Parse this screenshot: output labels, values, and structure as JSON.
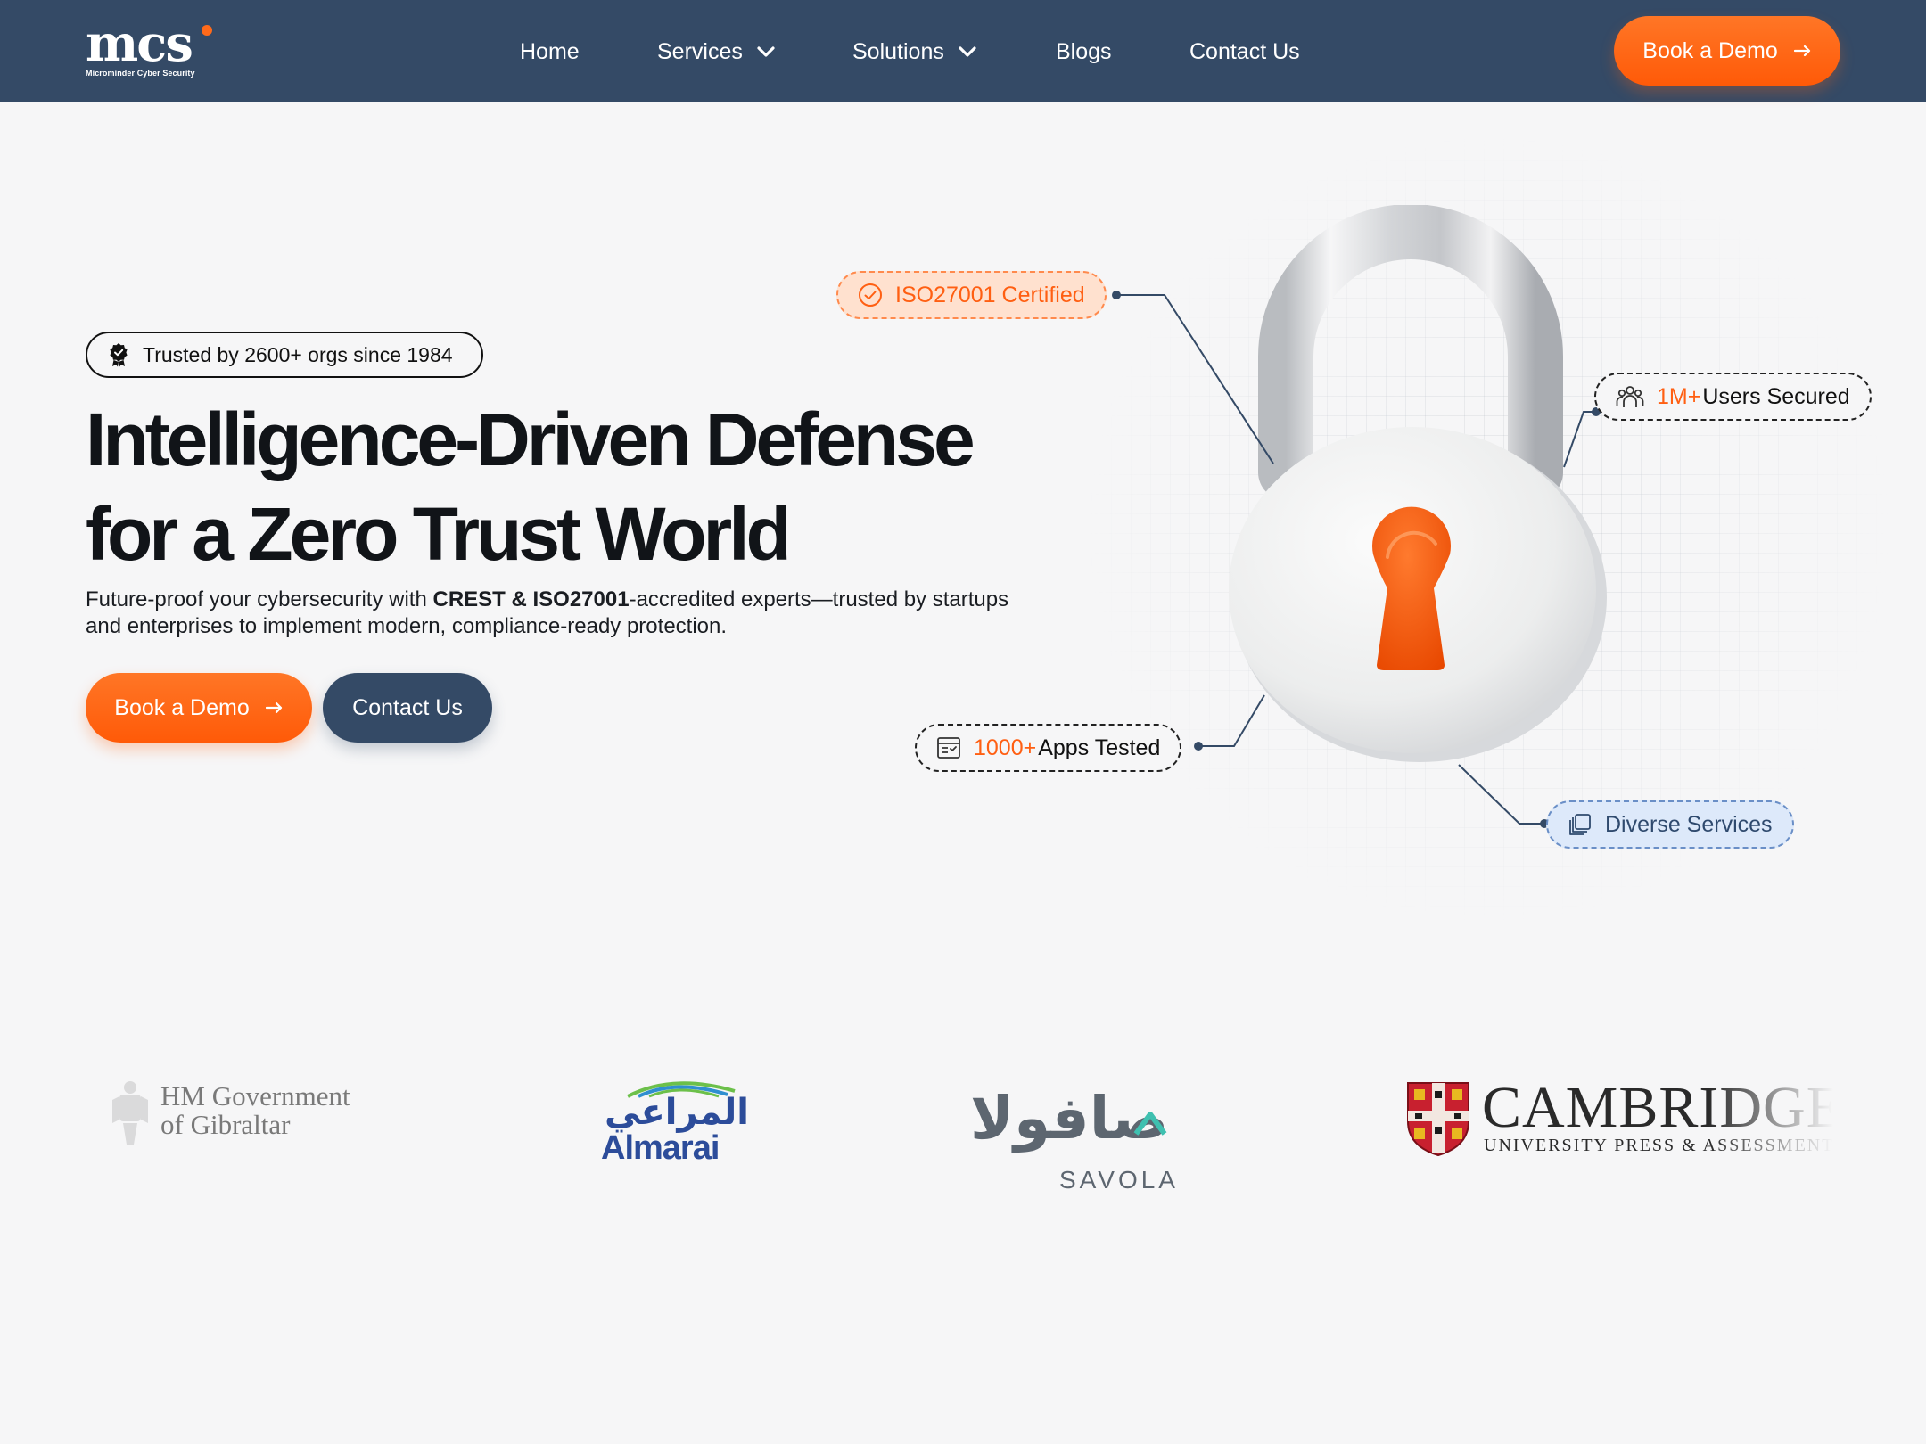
{
  "brand": {
    "logo_text": "mcs",
    "logo_tagline": "Microminder Cyber Security",
    "accent_orange": "#ff5f12",
    "navy": "#344a66"
  },
  "nav": {
    "items": [
      {
        "label": "Home",
        "has_dropdown": false
      },
      {
        "label": "Services",
        "has_dropdown": true
      },
      {
        "label": "Solutions",
        "has_dropdown": true
      },
      {
        "label": "Blogs",
        "has_dropdown": false
      },
      {
        "label": "Contact Us",
        "has_dropdown": false
      }
    ],
    "cta_label": "Book a Demo"
  },
  "hero": {
    "badge": "Trusted by 2600+ orgs since 1984",
    "headline_line1": "Intelligence-Driven Defense",
    "headline_line2": "for a Zero Trust World",
    "subtext_before": "Future-proof your cybersecurity with ",
    "subtext_bold": "CREST & ISO27001",
    "subtext_after": "-accredited experts—trusted by startups and enterprises to implement modern, compliance-ready protection.",
    "primary_cta": "Book a Demo",
    "secondary_cta": "Contact Us"
  },
  "callouts": {
    "iso": {
      "label": "ISO27001 Certified",
      "icon": "check-circle-icon"
    },
    "users": {
      "accent": "1M+",
      "label": "Users Secured",
      "icon": "users-icon"
    },
    "apps": {
      "accent": "1000+",
      "label": "Apps Tested",
      "icon": "checklist-icon"
    },
    "services": {
      "label": "Diverse Services",
      "icon": "layers-icon"
    }
  },
  "clients": {
    "gibraltar_line1": "HM Government",
    "gibraltar_line2": "of Gibraltar",
    "almarai_ar": "المراعي",
    "almarai_en": "Almarai",
    "savola_ar": "صافولا",
    "savola_en": "SAVOLA",
    "cambridge_main": "CAMBRIDGE",
    "cambridge_sub": "UNIVERSITY PRESS & ASSESSMENT"
  }
}
